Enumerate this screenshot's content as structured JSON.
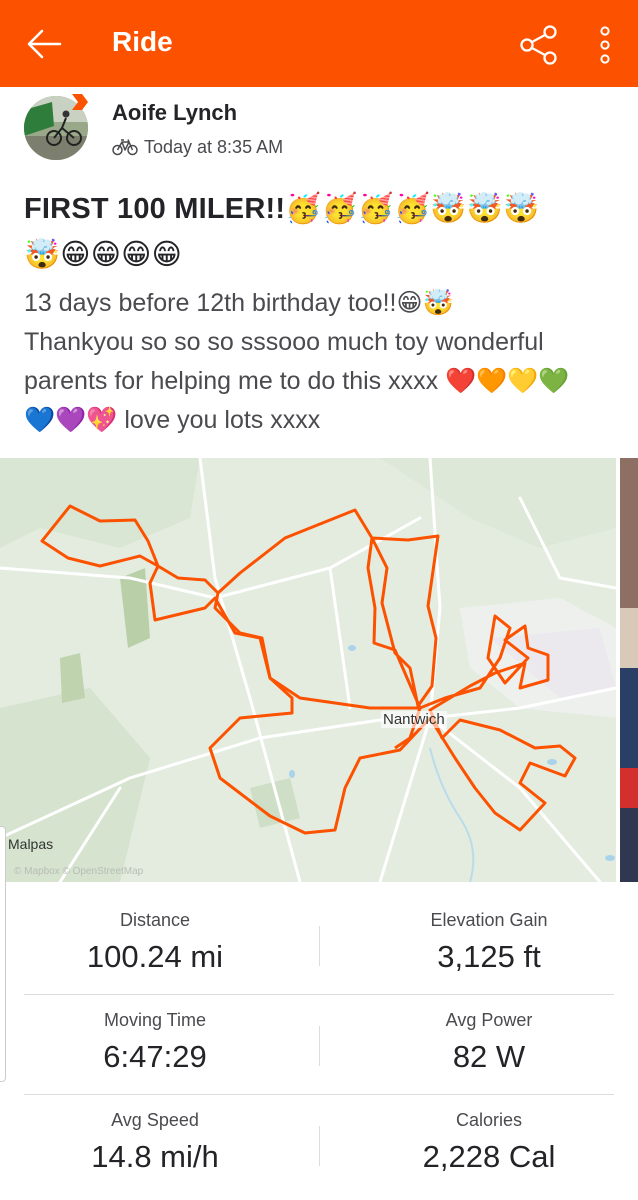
{
  "header": {
    "title": "Ride",
    "back_icon": "arrow-left-icon",
    "share_icon": "share-icon",
    "more_icon": "more-vertical-icon",
    "bar_color": "#fc5200"
  },
  "athlete": {
    "name": "Aoife Lynch",
    "activity_icon": "bicycle-icon",
    "time": "Today at 8:35 AM"
  },
  "post": {
    "title_line1": "FIRST 100 MILER!!🥳🥳🥳🥳🤯🤯🤯",
    "title_line2": "🤯😁😁😁😁",
    "body_line1": "13 days before 12th birthday too!!😁🤯",
    "body_line2": "Thankyou so so so sssooo much toy wonderful",
    "body_line3": "parents for helping me to do this xxxx ❤️🧡💛💚",
    "body_line4": "💙💜💖 love you lots xxxx"
  },
  "map": {
    "town_label": "Nantwich",
    "place_label": "Malpas",
    "credit": "© Mapbox © OpenStreetMap",
    "route_color": "#fc5200"
  },
  "stats": [
    {
      "label": "Distance",
      "value": "100.24 mi"
    },
    {
      "label": "Elevation Gain",
      "value": "3,125 ft"
    },
    {
      "label": "Moving Time",
      "value": "6:47:29"
    },
    {
      "label": "Avg Power",
      "value": "82 W"
    },
    {
      "label": "Avg Speed",
      "value": "14.8 mi/h"
    },
    {
      "label": "Calories",
      "value": "2,228 Cal"
    }
  ]
}
